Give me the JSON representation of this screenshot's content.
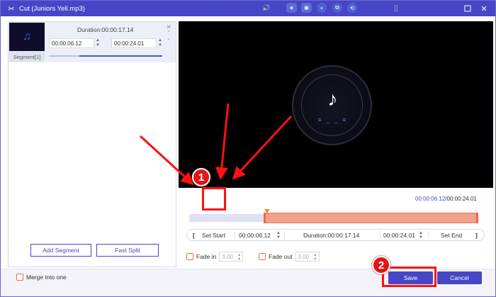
{
  "window": {
    "title": "Cut (Juniors Yell.mp3)",
    "app_icon": "scissors-icon",
    "controls": [
      "maximize-icon",
      "close-icon"
    ]
  },
  "segment_list": {
    "segment": {
      "label": "Segment[1]",
      "duration": "Duration:00:00:17.14",
      "start": "00:00:06.12",
      "end": "00:00:24.01",
      "thumbnail_icon": "music-note-icon"
    },
    "add_segment_label": "Add Segment",
    "fast_split_label": "Fast Split"
  },
  "preview": {
    "note_glyph": "♪",
    "eq_glyph": "≡ _ _ ≡"
  },
  "timecode": {
    "current": "00:00:06.12",
    "total": "/00:00:24.01"
  },
  "timeline": {
    "selection_start_fraction": 0.26,
    "selection_end_fraction": 1.0
  },
  "set_row": {
    "set_start_label": "Set Start",
    "start_value": "00:00:06.12",
    "duration": "Duration:00:00:17.14",
    "end_value": "00:00:24.01",
    "set_end_label": "Set End"
  },
  "fade": {
    "fade_in_label": "Fade in",
    "fade_in_value": "3.00",
    "fade_out_label": "Fade out",
    "fade_out_value": "3.00"
  },
  "footer": {
    "merge_label": "Merge into one",
    "save_label": "Save",
    "cancel_label": "Cancel"
  },
  "annotations": {
    "badge_1": "1",
    "badge_2": "2",
    "highlight_color": "#ff1111"
  },
  "colors": {
    "accent": "#4646c6",
    "selection": "#f3a08a",
    "checkbox": "#e8734e"
  }
}
